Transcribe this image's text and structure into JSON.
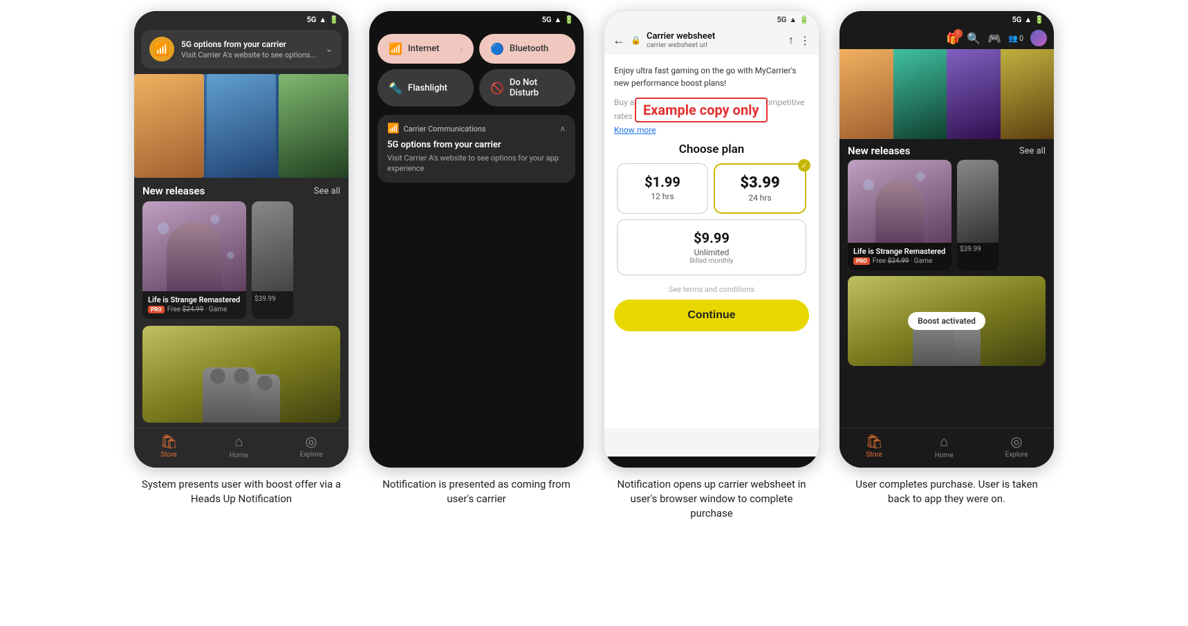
{
  "screens": [
    {
      "id": "screen1",
      "status": "5G",
      "notification": {
        "icon": "📶",
        "title": "5G options from your carrier",
        "body": "Visit Carrier A's website to see options..."
      },
      "section": {
        "title": "New releases",
        "see_all": "See all"
      },
      "game1": {
        "name": "Life is Strange Remastered",
        "badge": "PRO",
        "price_free": "Free",
        "price_original": "$24.99",
        "category": "Game"
      },
      "game2": {
        "partial_price": "$39.99"
      },
      "large_game": {},
      "nav": {
        "store": "Store",
        "home": "Home",
        "explore": "Explore"
      }
    },
    {
      "id": "screen2",
      "status": "5G",
      "quick_settings": {
        "internet": "Internet",
        "bluetooth": "Bluetooth",
        "flashlight": "Flashlight",
        "do_not_disturb": "Do Not Disturb"
      },
      "notification": {
        "source": "Carrier Communications",
        "title": "5G options from your carrier",
        "body": "Visit Carrier A's website to see options for your app experience"
      }
    },
    {
      "id": "screen3",
      "status": "5G",
      "header": {
        "title": "Carrier websheet",
        "url": "carrier websheet url"
      },
      "body": {
        "intro": "Enjoy ultra fast gaming on the go with MyCarrier's new performance boost plans!",
        "intro2": "Buy a pass to enjoy ultra fast gaming at competitive rates for the best experience!",
        "know_more": "Know more",
        "example_copy": "Example copy only",
        "choose_plan": "Choose plan"
      },
      "plans": [
        {
          "price": "$1.99",
          "duration": "12 hrs",
          "selected": false
        },
        {
          "price": "$3.99",
          "duration": "24 hrs",
          "selected": true
        },
        {
          "price": "$9.99",
          "duration": "Unlimited",
          "sub": "Billed monthly",
          "selected": false
        }
      ],
      "terms": "See terms and conditions",
      "continue_btn": "Continue"
    },
    {
      "id": "screen4",
      "status": "5G",
      "header": {
        "users_count": "0"
      },
      "section": {
        "title": "New releases",
        "see_all": "See all"
      },
      "game1": {
        "name": "Life is Strange Remastered",
        "badge": "PRO",
        "price_free": "Free",
        "price_original": "$24.99",
        "category": "Game"
      },
      "game2": {
        "partial_price": "$39.99"
      },
      "boost_badge": "Boost activated",
      "nav": {
        "store": "Store",
        "home": "Home",
        "explore": "Explore"
      }
    }
  ],
  "captions": [
    "System presents user with boost offer via a Heads Up Notification",
    "Notification is presented as coming from user's carrier",
    "Notification opens up carrier websheet in user's browser window to complete purchase",
    "User completes purchase. User is taken back to app they were on."
  ]
}
